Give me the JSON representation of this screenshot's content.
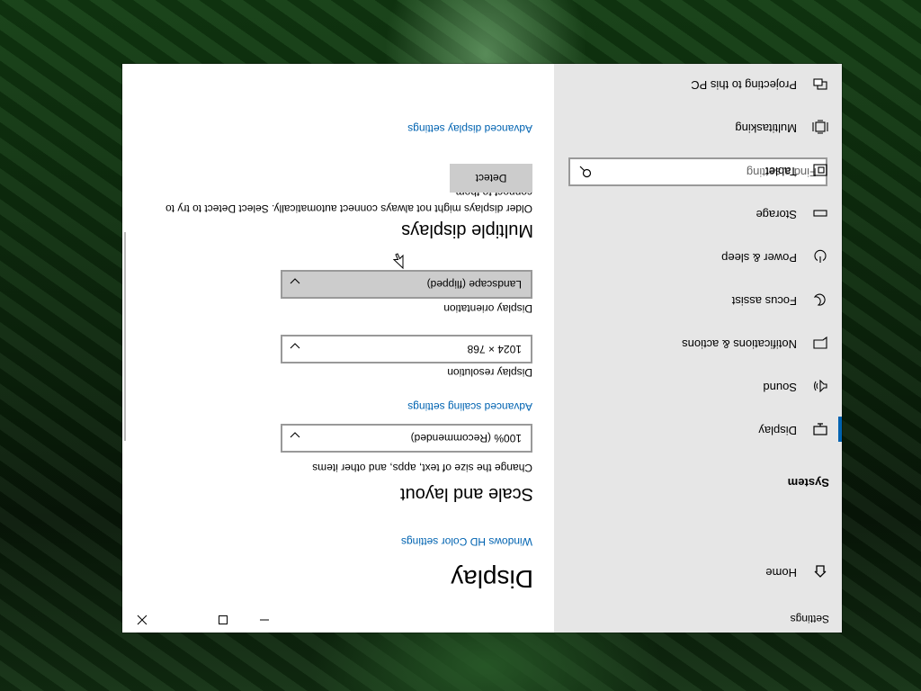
{
  "window": {
    "app_title": "Settings",
    "caption": {
      "minimize": "minimize-icon",
      "maximize": "maximize-icon",
      "close": "close-icon"
    }
  },
  "nav": {
    "home": "Home",
    "search_placeholder": "Find a setting",
    "section": "System",
    "items": [
      {
        "label": "Display",
        "icon": "display-icon",
        "active": true
      },
      {
        "label": "Sound",
        "icon": "speaker-icon"
      },
      {
        "label": "Notifications & actions",
        "icon": "notification-icon"
      },
      {
        "label": "Focus assist",
        "icon": "moon-icon"
      },
      {
        "label": "Power & sleep",
        "icon": "power-icon"
      },
      {
        "label": "Storage",
        "icon": "storage-icon"
      },
      {
        "label": "Tablet",
        "icon": "tablet-icon"
      },
      {
        "label": "Multitasking",
        "icon": "multitasking-icon"
      },
      {
        "label": "Projecting to this PC",
        "icon": "projector-icon"
      }
    ]
  },
  "content": {
    "title": "Display",
    "hd_color_link": "Windows HD Color settings",
    "scale_heading": "Scale and layout",
    "scale_label": "Change the size of text, apps, and other items",
    "scale_value": "100% (Recommended)",
    "advanced_scaling_link": "Advanced scaling settings",
    "resolution_label": "Display resolution",
    "resolution_value": "1024 × 768",
    "orientation_label": "Display orientation",
    "orientation_value": "Landscape (flipped)",
    "multiple_heading": "Multiple displays",
    "multiple_text": "Older displays might not always connect automatically. Select Detect to try to connect to them.",
    "detect_button": "Detect",
    "advanced_display_link": "Advanced display settings"
  },
  "colors": {
    "accent": "#0063b1",
    "nav_bg": "#e6e6e6",
    "content_bg": "#ffffff"
  }
}
